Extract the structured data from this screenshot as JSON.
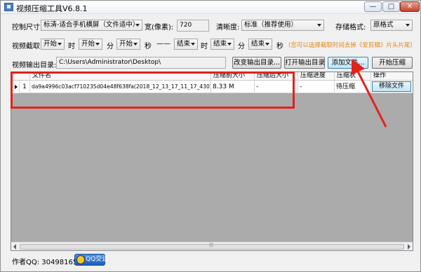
{
  "window": {
    "title": "视频压缩工具V6.8.1",
    "controls": {
      "minimize": "—",
      "maximize": "□",
      "close": "✕"
    }
  },
  "row1": {
    "size_label": "控制尺寸:",
    "size_value": "标清-适合手机横屏（文件适中）",
    "width_label": "宽(像素):",
    "width_value": "720",
    "clarity_label": "清晰度:",
    "clarity_value": "标准（推荐使用）",
    "format_label": "存储格式:",
    "format_value": "原格式"
  },
  "row2": {
    "clip_label": "视频截取:",
    "start_hour": "开始",
    "hour_unit": "时",
    "start_min": "开始",
    "min_unit": "分",
    "start_sec": "开始",
    "sec_unit": "秒",
    "separator": "——",
    "end_hour": "结束",
    "end_hour_unit": "时",
    "end_min": "结束",
    "end_min_unit": "分",
    "end_sec": "结束",
    "end_sec_unit": "秒",
    "hint": "(您可以选择截取时间去掉《爱剪辑》片头片尾)"
  },
  "row3": {
    "output_label": "视频输出目录:",
    "output_path": "C:\\Users\\Administrator\\Desktop\\",
    "change_dir": "改变输出目录...",
    "open_dir": "打开输出目录",
    "add_file": "添加文件...",
    "start": "开始压缩"
  },
  "table": {
    "columns": [
      "文件名",
      "压缩前大小",
      "压缩后大小",
      "压缩进度",
      "压缩状",
      "操作"
    ],
    "rows": [
      {
        "index": "1",
        "filename": "da9a4996c03acf710235d04e48f638fa(2018_12_13_17_11_17_430).avi",
        "size_before": "8.33 M",
        "size_after": "-",
        "progress": "-",
        "status": "待压缩",
        "action": "移除文件"
      }
    ]
  },
  "footer": {
    "author": "作者QQ: 3049816538",
    "qq_badge": "QQ交谈"
  },
  "colors": {
    "annotation_red": "#e3221a",
    "hint_orange": "#e88612"
  }
}
